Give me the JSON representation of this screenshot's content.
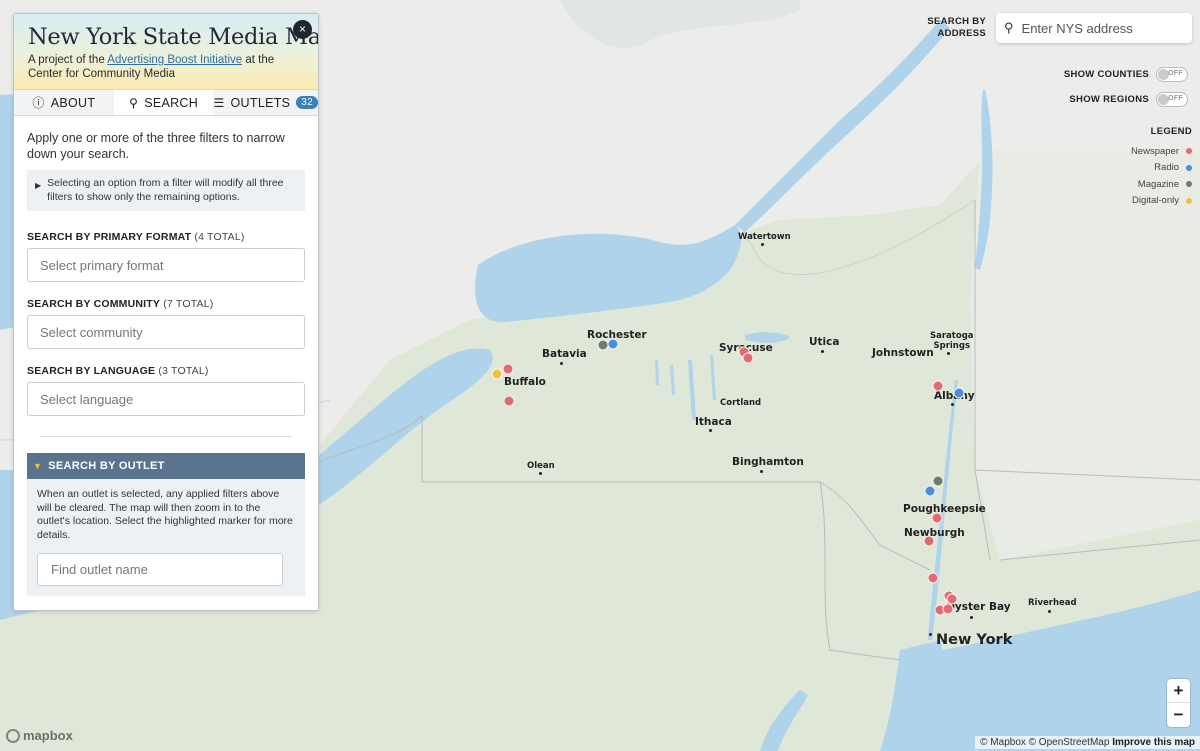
{
  "panel": {
    "title": "New York State Media Map",
    "subtitle_pre": "A project of the ",
    "subtitle_link": "Advertising Boost Initiative",
    "subtitle_post": " at the Center for Community Media",
    "close_label": "×",
    "tabs": [
      {
        "label": "ABOUT",
        "icon": "info-icon"
      },
      {
        "label": "SEARCH",
        "icon": "search-icon"
      },
      {
        "label": "OUTLETS",
        "icon": "list-icon",
        "badge": "32"
      }
    ],
    "intro": "Apply one or more of the three filters to narrow down your search.",
    "hint": "Selecting an option from a filter will modify all three filters to show only the remaining options.",
    "filters": [
      {
        "label": "SEARCH BY PRIMARY FORMAT",
        "count": "(4 TOTAL)",
        "placeholder": "Select primary format"
      },
      {
        "label": "SEARCH BY COMMUNITY",
        "count": "(7 TOTAL)",
        "placeholder": "Select community"
      },
      {
        "label": "SEARCH BY LANGUAGE",
        "count": "(3 TOTAL)",
        "placeholder": "Select language"
      }
    ],
    "outlet_section": {
      "heading": "SEARCH BY OUTLET",
      "description": "When an outlet is selected, any applied filters above will be cleared. The map will then zoom in to the outlet's location. Select the highlighted marker for more details.",
      "placeholder": "Find outlet name"
    }
  },
  "controls": {
    "search_label_line1": "SEARCH BY",
    "search_label_line2": "ADDRESS",
    "address_placeholder": "Enter NYS address",
    "show_counties": "SHOW COUNTIES",
    "show_regions": "SHOW REGIONS",
    "toggle_off": "OFF"
  },
  "legend": {
    "title": "LEGEND",
    "items": [
      {
        "label": "Newspaper",
        "color": "#e06b70"
      },
      {
        "label": "Radio",
        "color": "#4a8fd8"
      },
      {
        "label": "Magazine",
        "color": "#6b7d6a"
      },
      {
        "label": "Digital-only",
        "color": "#f0c040"
      }
    ]
  },
  "map": {
    "cities": [
      "Watertown",
      "Rochester",
      "Batavia",
      "Syracuse",
      "Utica",
      "Johnstown",
      "Saratoga Springs",
      "Buffalo",
      "Albany",
      "Cortland",
      "Ithaca",
      "Olean",
      "Binghamton",
      "Poughkeepsie",
      "Newburgh",
      "Oyster Bay",
      "Riverhead",
      "New York"
    ],
    "markers": [
      {
        "type": "Magazine",
        "city": "Rochester"
      },
      {
        "type": "Radio",
        "city": "Rochester"
      },
      {
        "type": "Newspaper",
        "city": "Syracuse"
      },
      {
        "type": "Newspaper",
        "city": "Syracuse"
      },
      {
        "type": "Newspaper",
        "city": "Buffalo"
      },
      {
        "type": "Digital-only",
        "city": "Buffalo"
      },
      {
        "type": "Newspaper",
        "city": "Buffalo"
      },
      {
        "type": "Newspaper",
        "city": "Albany"
      },
      {
        "type": "Radio",
        "city": "Albany"
      },
      {
        "type": "Magazine",
        "city": "Poughkeepsie"
      },
      {
        "type": "Radio",
        "city": "Poughkeepsie"
      },
      {
        "type": "Newspaper",
        "city": "Poughkeepsie"
      },
      {
        "type": "Newspaper",
        "city": "Newburgh"
      },
      {
        "type": "Newspaper",
        "city": "Westchester"
      },
      {
        "type": "Newspaper",
        "city": "New York"
      },
      {
        "type": "Newspaper",
        "city": "New York"
      },
      {
        "type": "Newspaper",
        "city": "New York"
      },
      {
        "type": "Newspaper",
        "city": "New York"
      }
    ],
    "zoom_in": "+",
    "zoom_out": "−",
    "logo_text": "mapbox",
    "attribution": "© Mapbox © OpenStreetMap",
    "improve": "Improve this map"
  }
}
